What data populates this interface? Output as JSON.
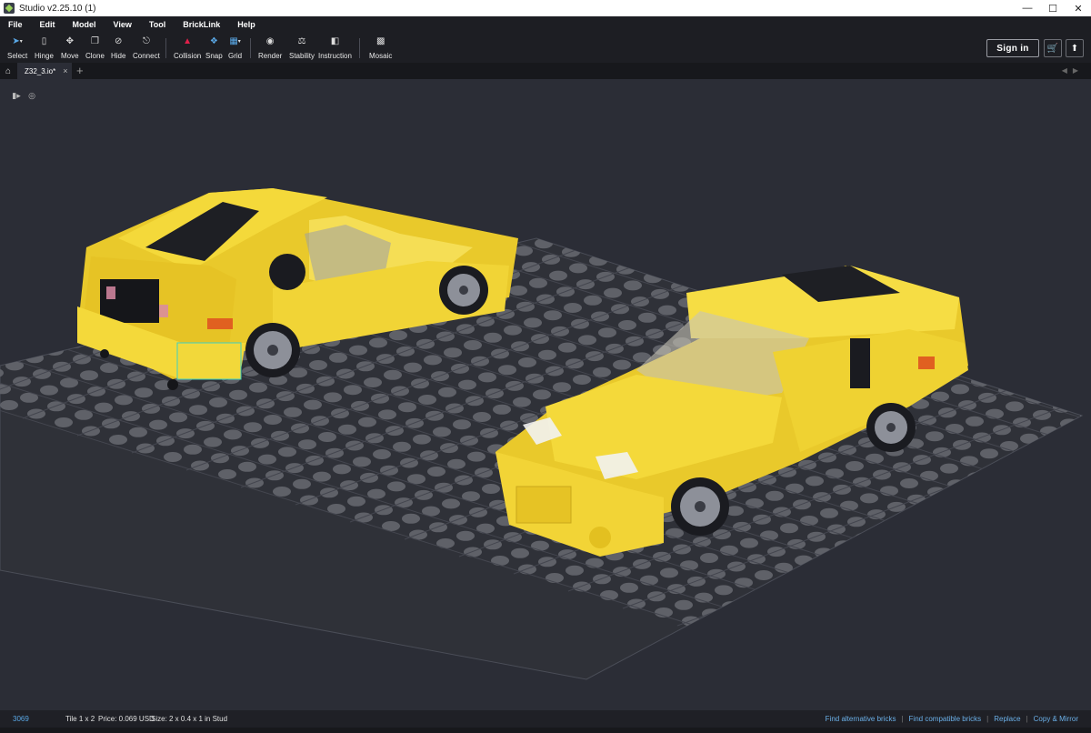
{
  "window": {
    "title": "Studio v2.25.10 (1)"
  },
  "menu": [
    "File",
    "Edit",
    "Model",
    "View",
    "Tool",
    "BrickLink",
    "Help"
  ],
  "toolbar": {
    "select": "Select",
    "hinge": "Hinge",
    "move": "Move",
    "clone": "Clone",
    "hide": "Hide",
    "connect": "Connect",
    "collision": "Collision",
    "snap": "Snap",
    "grid": "Grid",
    "render": "Render",
    "stability": "Stability",
    "instruction": "Instruction",
    "mosaic": "Mosaic",
    "sign_in": "Sign in"
  },
  "tabs": {
    "doc_tab": "Z32_3.io*"
  },
  "status": {
    "part_id": "3069",
    "part_name": "Tile 1 x 2",
    "price": "Price: 0.069 USD",
    "size": "Size: 2 x 0.4 x 1 in Stud",
    "links": [
      "Find alternative bricks",
      "Find compatible bricks",
      "Replace",
      "Copy & Mirror"
    ]
  },
  "colors": {
    "accent": "#5aa8e6",
    "collision": "#e0204a",
    "car_yellow": "#f4d93a",
    "baseplate": "#2f3138"
  },
  "icons": [
    "select-arrow-icon",
    "hinge-icon",
    "move-icon",
    "clone-icon",
    "hide-eye-icon",
    "connect-icon",
    "collision-triangle-icon",
    "snap-icon",
    "grid-icon",
    "camera-icon",
    "stability-icon",
    "instruction-icon",
    "mosaic-icon",
    "cart-icon",
    "upload-icon",
    "home-icon",
    "video-camera-icon",
    "target-icon"
  ]
}
